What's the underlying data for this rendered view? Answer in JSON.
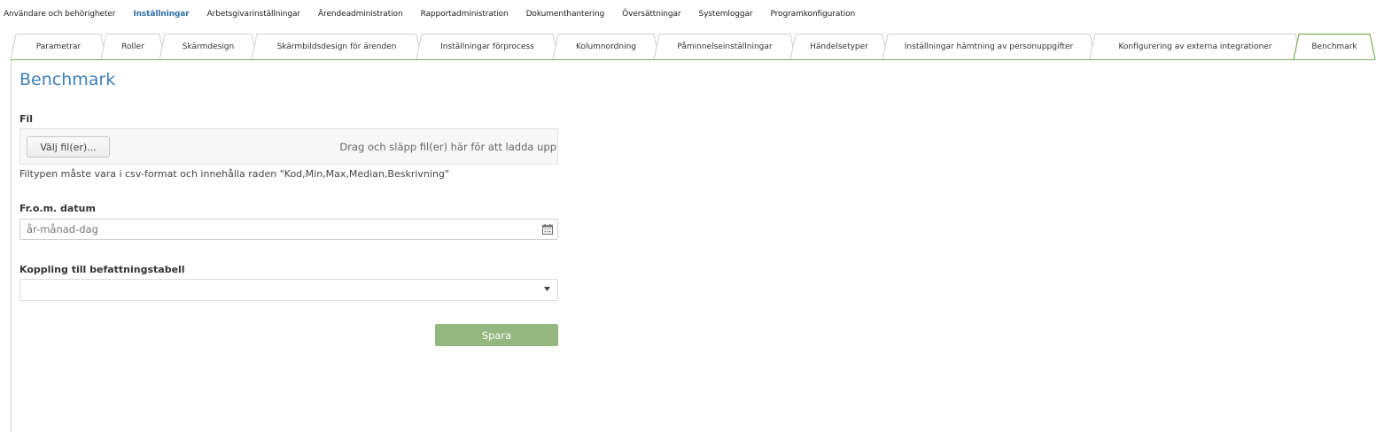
{
  "nav": {
    "items": [
      {
        "label": "Användare och behörigheter",
        "active": false
      },
      {
        "label": "Inställningar",
        "active": true
      },
      {
        "label": "Arbetsgivarinställningar",
        "active": false
      },
      {
        "label": "Ärendeadministration",
        "active": false
      },
      {
        "label": "Rapportadministration",
        "active": false
      },
      {
        "label": "Dokumenthantering",
        "active": false
      },
      {
        "label": "Översättningar",
        "active": false
      },
      {
        "label": "Systemloggar",
        "active": false
      },
      {
        "label": "Programkonfiguration",
        "active": false
      }
    ]
  },
  "tabs": [
    {
      "label": "Parametrar",
      "active": false
    },
    {
      "label": "Roller",
      "active": false
    },
    {
      "label": "Skärmdesign",
      "active": false
    },
    {
      "label": "Skärmbildsdesign för ärenden",
      "active": false
    },
    {
      "label": "Inställningar förprocess",
      "active": false
    },
    {
      "label": "Kolumnordning",
      "active": false
    },
    {
      "label": "Påminnelseinställningar",
      "active": false
    },
    {
      "label": "Händelsetyper",
      "active": false
    },
    {
      "label": "Inställningar hämtning av personuppgifter",
      "active": false
    },
    {
      "label": "Konfigurering av externa integrationer",
      "active": false
    },
    {
      "label": "Benchmark",
      "active": true
    }
  ],
  "page": {
    "title": "Benchmark"
  },
  "form": {
    "file_label": "Fil",
    "choose_files_label": "Välj fil(er)...",
    "drop_hint": "Drag och släpp fil(er) här för att ladda upp",
    "file_hint": "Filtypen måste vara i csv-format och innehålla raden \"Kod,Min,Max,Median,Beskrivning\"",
    "date_label": "Fr.o.m. datum",
    "date_placeholder": "år-månad-dag",
    "date_value": "",
    "position_table_label": "Koppling till befattningstabell",
    "position_table_value": "",
    "save_label": "Spara"
  },
  "colors": {
    "accent_blue": "#3f7fb5",
    "active_nav": "#2f6fa5",
    "tab_active_border": "#7cae55",
    "save_button": "#93b77e"
  },
  "icons": {
    "date_picker": "calendar-icon",
    "select_toggle": "caret-down-icon"
  }
}
